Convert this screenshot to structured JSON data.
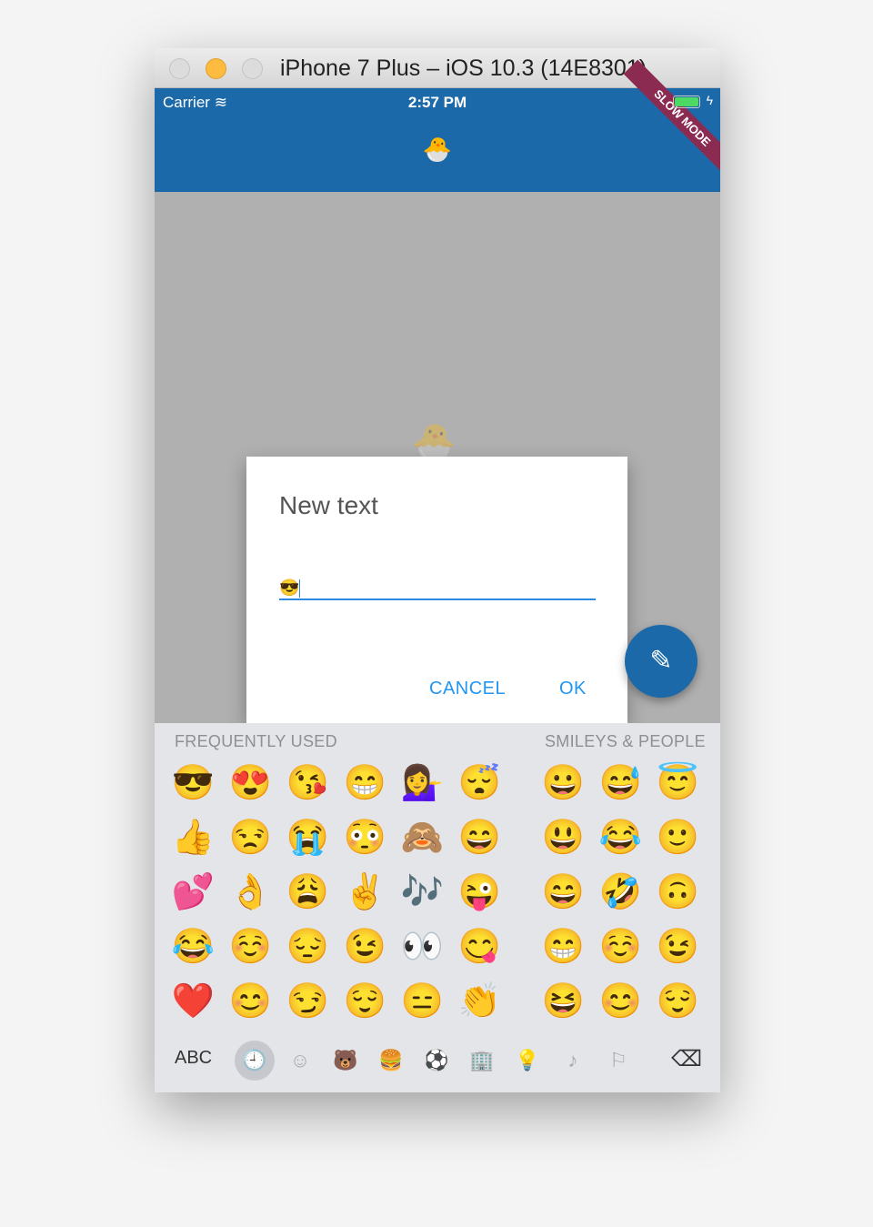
{
  "window": {
    "title": "iPhone 7 Plus – iOS 10.3 (14E8301)"
  },
  "status_bar": {
    "carrier": "Carrier",
    "time": "2:57 PM",
    "battery_level": 1.0,
    "banner": "SLOW MODE"
  },
  "app_bar": {
    "logo": "🐣"
  },
  "dialog": {
    "title": "New text",
    "value": "😎",
    "cancel": "CANCEL",
    "ok": "OK"
  },
  "fab": {
    "icon": "✎"
  },
  "keyboard": {
    "frequent_label": "FREQUENTLY USED",
    "smileys_label": "SMILEYS & PEOPLE",
    "frequent": [
      "😎",
      "😍",
      "😘",
      "😁",
      "💁‍♀️",
      "😴",
      "👍",
      "😒",
      "😭",
      "😳",
      "🙈",
      "😄",
      "💕",
      "👌",
      "😩",
      "✌️",
      "🎶",
      "😜",
      "😂",
      "☺️",
      "😔",
      "😉",
      "👀",
      "😋",
      "❤️",
      "😊",
      "😏",
      "😌",
      "😑",
      "👏"
    ],
    "smileys": [
      "😀",
      "😅",
      "😇",
      "😃",
      "😂",
      "🙂",
      "😄",
      "🤣",
      "🙃",
      "😁",
      "☺️",
      "😉",
      "😆",
      "😊",
      "😌"
    ],
    "abc": "ABC",
    "categories": [
      "🕘",
      "☺",
      "🐻",
      "🍔",
      "⚽",
      "🏢",
      "💡",
      "♪",
      "⚐"
    ],
    "delete": "⌫"
  }
}
